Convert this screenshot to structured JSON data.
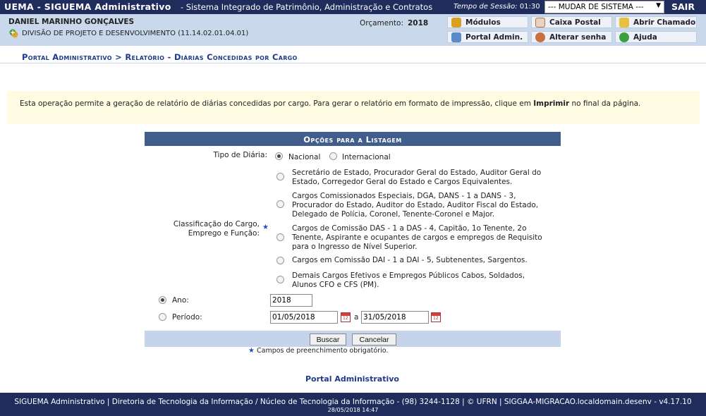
{
  "topbar": {
    "brand": "UEMA - SIGUEMA Administrativo",
    "subtitle": "- Sistema Integrado de Patrimônio, Administração e Contratos",
    "session_label": "Tempo de Sessão:",
    "session_time": "01:30",
    "system_select": "--- MUDAR DE SISTEMA ---",
    "logout": "SAIR"
  },
  "user": {
    "name": "DANIEL MARINHO GONÇALVES",
    "unit": "DIVISÃO DE PROJETO E DESENVOLVIMENTO (11.14.02.01.04.01)",
    "budget_label": "Orçamento:",
    "budget_year": "2018"
  },
  "quick": {
    "modulos": "Módulos",
    "caixa": "Caixa Postal",
    "chamado": "Abrir Chamado",
    "portal": "Portal Admin.",
    "senha": "Alterar senha",
    "ajuda": "Ajuda"
  },
  "breadcrumb": "Portal Administrativo > Relatório - Diárias Concedidas por Cargo",
  "info": {
    "text_before": "Esta operação permite a geração de relatório de diárias concedidas por cargo. Para gerar o relatório em formato de impressão, clique em ",
    "bold": "Imprimir",
    "text_after": " no final da página."
  },
  "form": {
    "title": "Opções para a Listagem",
    "tipo_label": "Tipo de Diária:",
    "tipo_nacional": "Nacional",
    "tipo_internacional": "Internacional",
    "class_label": "Classificação do Cargo, Emprego e Função:",
    "options": [
      "Secretário de Estado, Procurador Geral do Estado, Auditor Geral do Estado, Corregedor Geral do Estado e Cargos Equivalentes.",
      "Cargos Comissionados Especiais, DGA, DANS - 1 a DANS - 3, Procurador do Estado, Auditor do Estado, Auditor Fiscal do Estado, Delegado de Polícia, Coronel, Tenente-Coronel e Major.",
      "Cargos de Comissão DAS - 1 a DAS - 4, Capitão, 1o Tenente, 2o Tenente, Aspirante e ocupantes de cargos e empregos de Requisito para o Ingresso de Nível Superior.",
      "Cargos em Comissão DAI - 1 a DAI - 5, Subtenentes, Sargentos.",
      "Demais Cargos Efetivos e Empregos Públicos Cabos, Soldados, Alunos CFO e CFS (PM)."
    ],
    "ano_label": "Ano:",
    "ano_value": "2018",
    "periodo_label": "Período:",
    "periodo_start": "01/05/2018",
    "periodo_sep": "a",
    "periodo_end": "31/05/2018",
    "buscar": "Buscar",
    "cancelar": "Cancelar"
  },
  "required_note": "Campos de preenchimento obrigatório.",
  "portal_link": "Portal Administrativo",
  "footer": {
    "line1": "SIGUEMA Administrativo | Diretoria de Tecnologia da Informação / Núcleo de Tecnologia da Informação - (98) 3244-1128 | © UFRN | SIGGAA-MIGRACAO.localdomain.desenv - v4.17.10",
    "line2": "28/05/2018 14:47"
  }
}
